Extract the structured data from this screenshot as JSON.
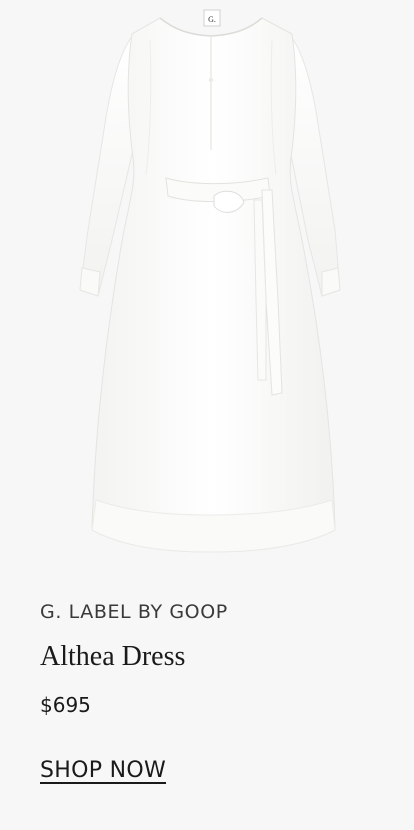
{
  "product": {
    "image_alt": "White long-sleeve belted midi dress",
    "label_tag_text": "G.",
    "brand": "G. LABEL BY GOOP",
    "name": "Althea Dress",
    "price": "$695",
    "cta_label": "SHOP NOW"
  },
  "colors": {
    "background": "#f7f7f7",
    "dress": "#ffffff",
    "text": "#1a1a1a",
    "brand_text": "#3a3a3a"
  }
}
